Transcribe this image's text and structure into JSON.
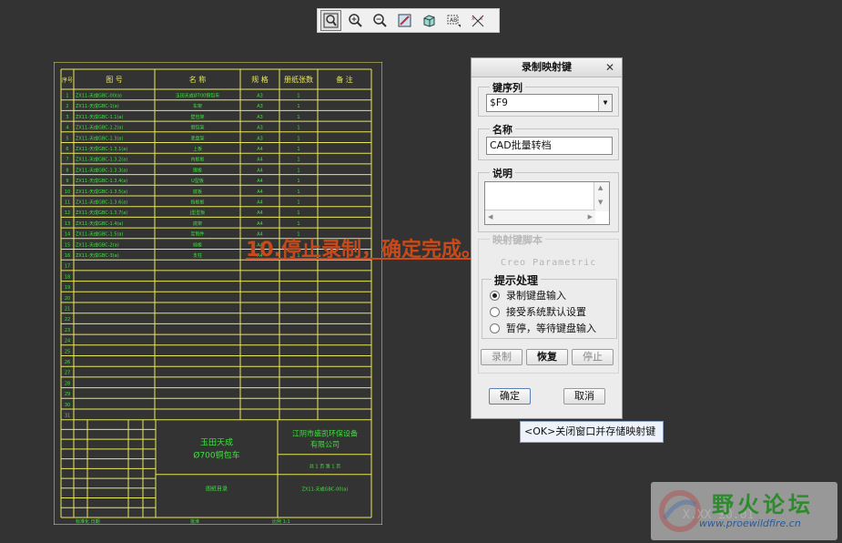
{
  "toolbar": {
    "buttons": [
      {
        "name": "zoom-fit-icon",
        "active": true
      },
      {
        "name": "zoom-in-icon",
        "active": false
      },
      {
        "name": "zoom-out-icon",
        "active": false
      },
      {
        "name": "repaint-icon",
        "active": false
      },
      {
        "name": "display-style-icon",
        "active": false
      },
      {
        "name": "annotation-display-icon",
        "active": false
      },
      {
        "name": "datum-display-icon",
        "active": false
      }
    ]
  },
  "drawing": {
    "header": [
      "序号",
      "图 号",
      "名 称",
      "规 格",
      "册纸张数",
      "备 注"
    ],
    "rows": [
      {
        "no": "1",
        "code": "ZX11-天成GBC-00(a)",
        "name": "玉田天成Ø700铜包车",
        "spec": "A3",
        "sheets": "1"
      },
      {
        "no": "2",
        "code": "ZX11-天成GBC-1(a)",
        "name": "车架",
        "spec": "A3",
        "sheets": "1"
      },
      {
        "no": "3",
        "code": "ZX11-天成GBC-1.1(a)",
        "name": "壁包架",
        "spec": "A3",
        "sheets": "1"
      },
      {
        "no": "4",
        "code": "ZX11-天成GBC-1.2(a)",
        "name": "侧包架",
        "spec": "A3",
        "sheets": "1"
      },
      {
        "no": "5",
        "code": "ZX11-天成GBC-1.3(a)",
        "name": "底盘架",
        "spec": "A3",
        "sheets": "1"
      },
      {
        "no": "6",
        "code": "ZX11-天成GBC-1.3.1(a)",
        "name": "上板",
        "spec": "A4",
        "sheets": "1"
      },
      {
        "no": "7",
        "code": "ZX11-天成GBC-1.3.2(a)",
        "name": "内板板",
        "spec": "A4",
        "sheets": "1"
      },
      {
        "no": "8",
        "code": "ZX11-天成GBC-1.3.3(a)",
        "name": "围板",
        "spec": "A4",
        "sheets": "1"
      },
      {
        "no": "9",
        "code": "ZX11-天成GBC-1.3.4(a)",
        "name": "U型板",
        "spec": "A4",
        "sheets": "1"
      },
      {
        "no": "10",
        "code": "ZX11-天成GBC-1.3.5(a)",
        "name": "底板",
        "spec": "A4",
        "sheets": "1"
      },
      {
        "no": "11",
        "code": "ZX11-天成GBC-1.3.6(a)",
        "name": "挡板板",
        "spec": "A4",
        "sheets": "1"
      },
      {
        "no": "12",
        "code": "ZX11-天成GBC-1.3.7(a)",
        "name": "J型型板",
        "spec": "A4",
        "sheets": "1"
      },
      {
        "no": "13",
        "code": "ZX11-天成GBC-1.4(a)",
        "name": "底架",
        "spec": "A4",
        "sheets": "1"
      },
      {
        "no": "14",
        "code": "ZX11-天成GBC-1.5(a)",
        "name": "定制件",
        "spec": "A4",
        "sheets": "1"
      },
      {
        "no": "15",
        "code": "ZX11-天成GBC-2(a)",
        "name": "挡板",
        "spec": "A4",
        "sheets": "1"
      },
      {
        "no": "16",
        "code": "ZX11-天成GBC-3(a)",
        "name": "支柱",
        "spec": "A4",
        "sheets": "1"
      }
    ],
    "empty_row_numbers": [
      "17",
      "18",
      "19",
      "20",
      "21",
      "22",
      "23",
      "24",
      "25",
      "26",
      "27",
      "28",
      "29",
      "30",
      "31"
    ],
    "title_block": {
      "product_line1": "玉田天成",
      "product_line2": "Ø700铜包车",
      "company_line1": "江阴市盛凯环保设备",
      "company_line2": "有限公司",
      "sheet_info": "共 1 页   第 1 页",
      "doc_name": "图纸目录",
      "doc_code": "ZX11-天成GBC-00(a)",
      "footer_left": "标准化 日期",
      "footer_mid": "批准",
      "footer_right": "比例 1:1"
    }
  },
  "caption": "10.停止录制，确定完成。",
  "dialog": {
    "title": "录制映射键",
    "key_sequence_label": "键序列",
    "key_sequence_value": "$F9",
    "name_label": "名称",
    "name_value": "CAD批量转档",
    "description_label": "说明",
    "hidden_section_label": "映射键脚本",
    "hidden_section_text": "Creo Parametric",
    "prompt_group_label": "提示处理",
    "options": [
      {
        "label": "录制键盘输入",
        "checked": true
      },
      {
        "label": "接受系统默认设置",
        "checked": false
      },
      {
        "label": "暂停，等待键盘输入",
        "checked": false
      }
    ],
    "record_button": "录制",
    "resume_button": "恢复",
    "stop_button": "停止",
    "ok_button": "确定",
    "cancel_button": "取消"
  },
  "tooltip": "<OK>关闭窗口并存储映射键",
  "watermark": {
    "title": "野火论坛",
    "url": "www.proewildfire.cn",
    "formula": "X.XX ±0.01"
  },
  "colors": {
    "background": "#333333",
    "cad_lines": "#e8e85a",
    "cad_text": "#40e040",
    "caption": "#c8491a"
  }
}
